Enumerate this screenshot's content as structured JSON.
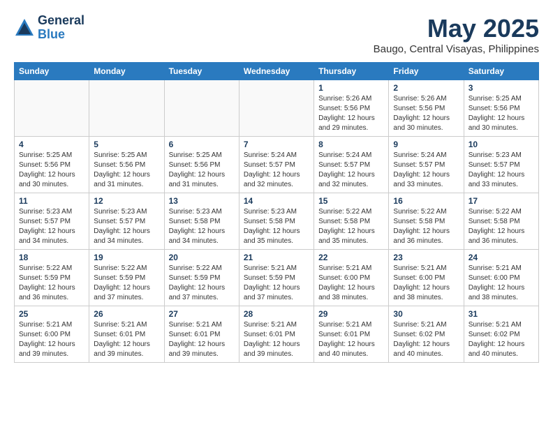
{
  "header": {
    "logo_general": "General",
    "logo_blue": "Blue",
    "month_title": "May 2025",
    "location": "Baugo, Central Visayas, Philippines"
  },
  "weekdays": [
    "Sunday",
    "Monday",
    "Tuesday",
    "Wednesday",
    "Thursday",
    "Friday",
    "Saturday"
  ],
  "weeks": [
    [
      {
        "day": "",
        "info": ""
      },
      {
        "day": "",
        "info": ""
      },
      {
        "day": "",
        "info": ""
      },
      {
        "day": "",
        "info": ""
      },
      {
        "day": "1",
        "info": "Sunrise: 5:26 AM\nSunset: 5:56 PM\nDaylight: 12 hours\nand 29 minutes."
      },
      {
        "day": "2",
        "info": "Sunrise: 5:26 AM\nSunset: 5:56 PM\nDaylight: 12 hours\nand 30 minutes."
      },
      {
        "day": "3",
        "info": "Sunrise: 5:25 AM\nSunset: 5:56 PM\nDaylight: 12 hours\nand 30 minutes."
      }
    ],
    [
      {
        "day": "4",
        "info": "Sunrise: 5:25 AM\nSunset: 5:56 PM\nDaylight: 12 hours\nand 30 minutes."
      },
      {
        "day": "5",
        "info": "Sunrise: 5:25 AM\nSunset: 5:56 PM\nDaylight: 12 hours\nand 31 minutes."
      },
      {
        "day": "6",
        "info": "Sunrise: 5:25 AM\nSunset: 5:56 PM\nDaylight: 12 hours\nand 31 minutes."
      },
      {
        "day": "7",
        "info": "Sunrise: 5:24 AM\nSunset: 5:57 PM\nDaylight: 12 hours\nand 32 minutes."
      },
      {
        "day": "8",
        "info": "Sunrise: 5:24 AM\nSunset: 5:57 PM\nDaylight: 12 hours\nand 32 minutes."
      },
      {
        "day": "9",
        "info": "Sunrise: 5:24 AM\nSunset: 5:57 PM\nDaylight: 12 hours\nand 33 minutes."
      },
      {
        "day": "10",
        "info": "Sunrise: 5:23 AM\nSunset: 5:57 PM\nDaylight: 12 hours\nand 33 minutes."
      }
    ],
    [
      {
        "day": "11",
        "info": "Sunrise: 5:23 AM\nSunset: 5:57 PM\nDaylight: 12 hours\nand 34 minutes."
      },
      {
        "day": "12",
        "info": "Sunrise: 5:23 AM\nSunset: 5:57 PM\nDaylight: 12 hours\nand 34 minutes."
      },
      {
        "day": "13",
        "info": "Sunrise: 5:23 AM\nSunset: 5:58 PM\nDaylight: 12 hours\nand 34 minutes."
      },
      {
        "day": "14",
        "info": "Sunrise: 5:23 AM\nSunset: 5:58 PM\nDaylight: 12 hours\nand 35 minutes."
      },
      {
        "day": "15",
        "info": "Sunrise: 5:22 AM\nSunset: 5:58 PM\nDaylight: 12 hours\nand 35 minutes."
      },
      {
        "day": "16",
        "info": "Sunrise: 5:22 AM\nSunset: 5:58 PM\nDaylight: 12 hours\nand 36 minutes."
      },
      {
        "day": "17",
        "info": "Sunrise: 5:22 AM\nSunset: 5:58 PM\nDaylight: 12 hours\nand 36 minutes."
      }
    ],
    [
      {
        "day": "18",
        "info": "Sunrise: 5:22 AM\nSunset: 5:59 PM\nDaylight: 12 hours\nand 36 minutes."
      },
      {
        "day": "19",
        "info": "Sunrise: 5:22 AM\nSunset: 5:59 PM\nDaylight: 12 hours\nand 37 minutes."
      },
      {
        "day": "20",
        "info": "Sunrise: 5:22 AM\nSunset: 5:59 PM\nDaylight: 12 hours\nand 37 minutes."
      },
      {
        "day": "21",
        "info": "Sunrise: 5:21 AM\nSunset: 5:59 PM\nDaylight: 12 hours\nand 37 minutes."
      },
      {
        "day": "22",
        "info": "Sunrise: 5:21 AM\nSunset: 6:00 PM\nDaylight: 12 hours\nand 38 minutes."
      },
      {
        "day": "23",
        "info": "Sunrise: 5:21 AM\nSunset: 6:00 PM\nDaylight: 12 hours\nand 38 minutes."
      },
      {
        "day": "24",
        "info": "Sunrise: 5:21 AM\nSunset: 6:00 PM\nDaylight: 12 hours\nand 38 minutes."
      }
    ],
    [
      {
        "day": "25",
        "info": "Sunrise: 5:21 AM\nSunset: 6:00 PM\nDaylight: 12 hours\nand 39 minutes."
      },
      {
        "day": "26",
        "info": "Sunrise: 5:21 AM\nSunset: 6:01 PM\nDaylight: 12 hours\nand 39 minutes."
      },
      {
        "day": "27",
        "info": "Sunrise: 5:21 AM\nSunset: 6:01 PM\nDaylight: 12 hours\nand 39 minutes."
      },
      {
        "day": "28",
        "info": "Sunrise: 5:21 AM\nSunset: 6:01 PM\nDaylight: 12 hours\nand 39 minutes."
      },
      {
        "day": "29",
        "info": "Sunrise: 5:21 AM\nSunset: 6:01 PM\nDaylight: 12 hours\nand 40 minutes."
      },
      {
        "day": "30",
        "info": "Sunrise: 5:21 AM\nSunset: 6:02 PM\nDaylight: 12 hours\nand 40 minutes."
      },
      {
        "day": "31",
        "info": "Sunrise: 5:21 AM\nSunset: 6:02 PM\nDaylight: 12 hours\nand 40 minutes."
      }
    ]
  ]
}
